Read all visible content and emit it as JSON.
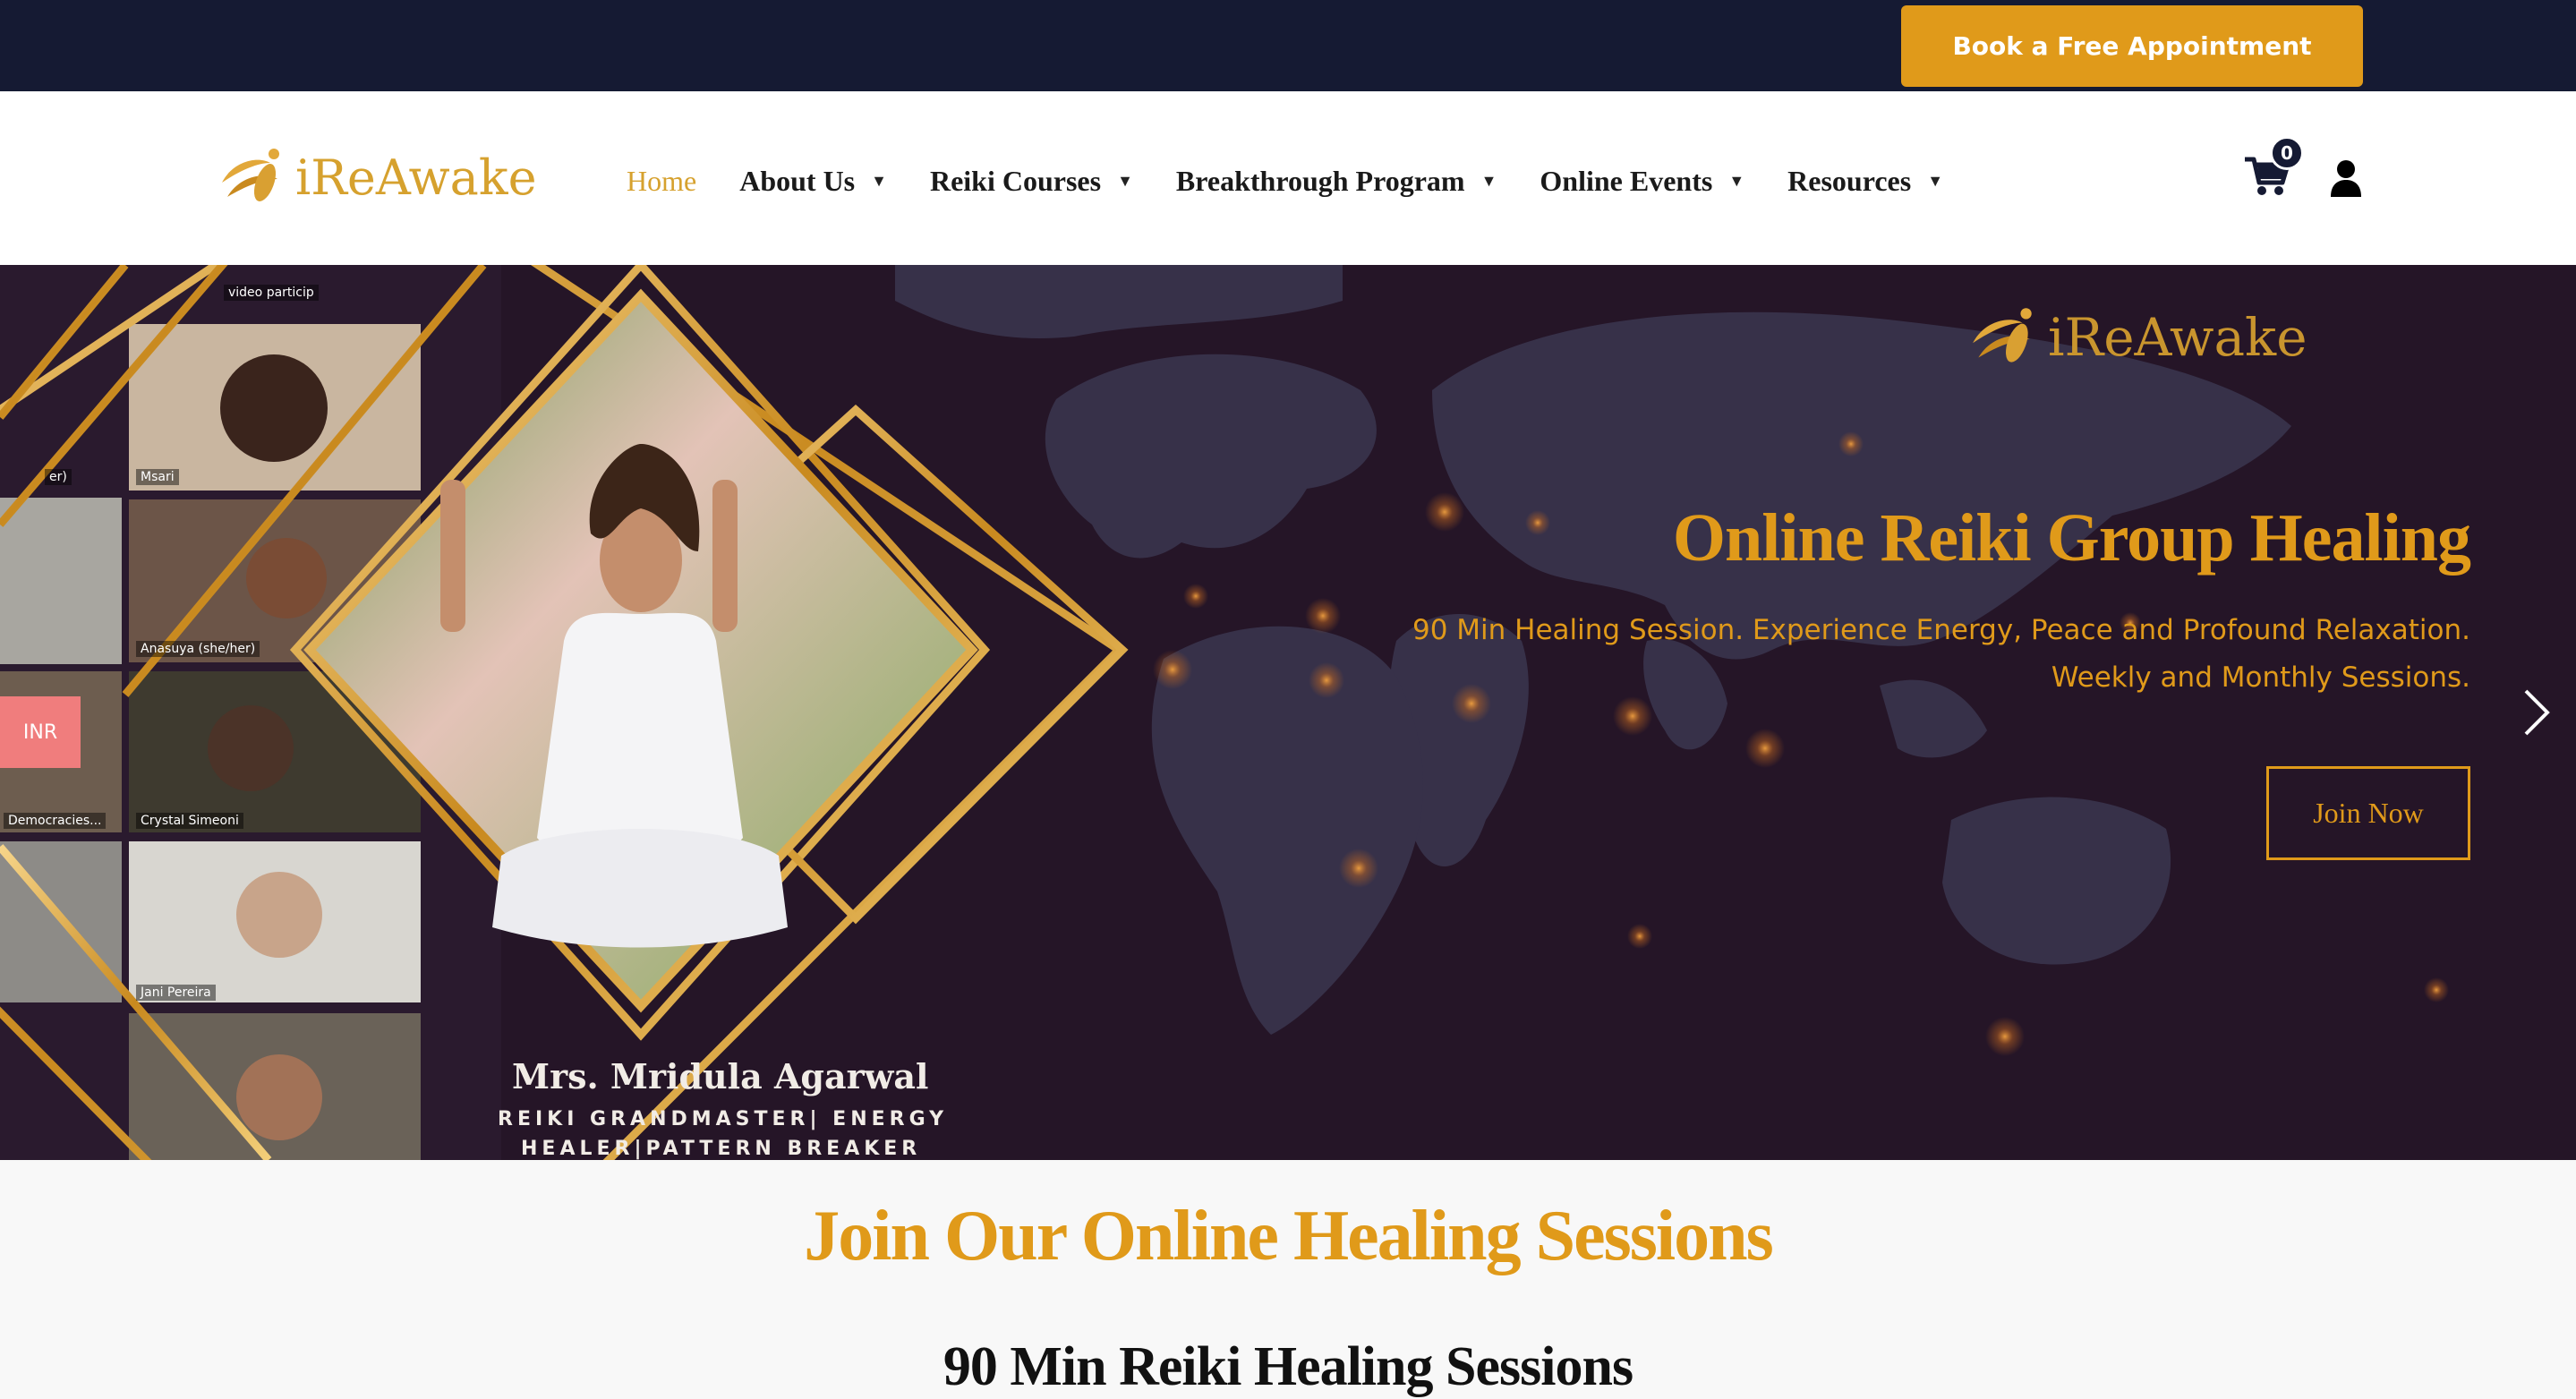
{
  "topbar": {
    "book_label": "Book a Free Appointment"
  },
  "header": {
    "logo_text": "iReAwake",
    "nav": [
      {
        "label": "Home",
        "has_dropdown": false,
        "active": true
      },
      {
        "label": "About Us",
        "has_dropdown": true
      },
      {
        "label": "Reiki Courses",
        "has_dropdown": true
      },
      {
        "label": "Breakthrough Program",
        "has_dropdown": true
      },
      {
        "label": "Online Events",
        "has_dropdown": true
      },
      {
        "label": "Resources",
        "has_dropdown": true
      }
    ],
    "cart_count": "0",
    "cart_icon": "cart-icon",
    "user_icon": "user-icon"
  },
  "hero": {
    "logo_text": "iReAwake",
    "title": "Online Reiki Group Healing",
    "subtitle_line1": "90 Min Healing Session. Experience Energy, Peace and Profound Relaxation.",
    "subtitle_line2": "Weekly and Monthly Sessions.",
    "cta_label": "Join Now",
    "currency_label": "INR",
    "presenter_name": "Mrs. Mridula Agarwal",
    "presenter_title_line1": "REIKI GRANDMASTER| ENERGY",
    "presenter_title_line2": "HEALER|PATTERN BREAKER",
    "tile_labels": [
      "video particip",
      "er)",
      "Msari",
      "Anasuya (she/her)",
      "Democracies...",
      "Crystal Simeoni",
      "Jani Pereira"
    ],
    "next_icon": "chevron-right-icon"
  },
  "section": {
    "title": "Join Our Online Healing Sessions",
    "subtitle": "90 Min Reiki Healing Sessions"
  },
  "colors": {
    "accent": "#e09a1a",
    "dark_navy": "#151a33",
    "hero_bg": "#241428",
    "logo_gold": "#d6a12e",
    "inr_badge": "#f07d7d"
  }
}
